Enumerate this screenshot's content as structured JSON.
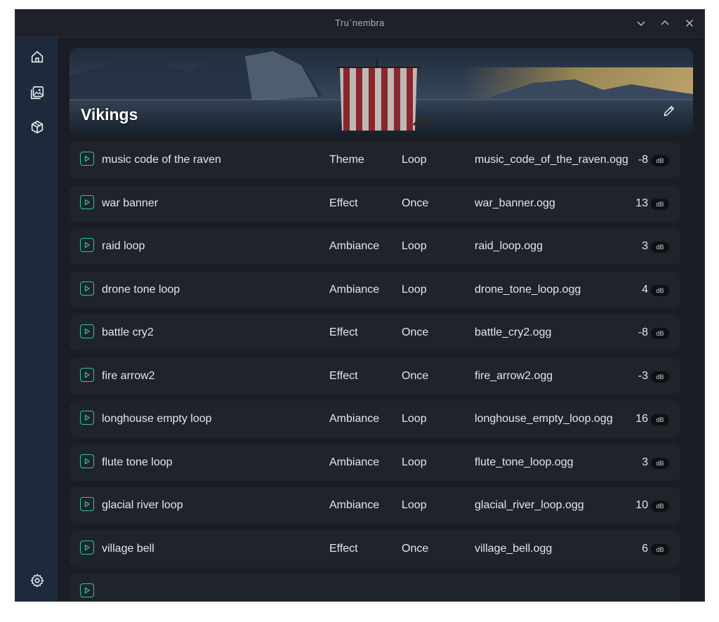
{
  "window": {
    "title": "Tru`nembra",
    "controls": [
      "chevron-down-icon",
      "chevron-up-icon",
      "close-icon"
    ]
  },
  "sidebar": {
    "items": [
      {
        "name": "home",
        "icon": "home-icon"
      },
      {
        "name": "gallery",
        "icon": "image-gallery-icon"
      },
      {
        "name": "packages",
        "icon": "package-icon"
      }
    ],
    "bottom": {
      "name": "settings",
      "icon": "gear-icon"
    }
  },
  "banner": {
    "title": "Vikings",
    "edit_icon": "pencil-icon"
  },
  "unit_label": "dB",
  "colors": {
    "accent": "#2dc4a8",
    "sidebar": "#1d2a3b",
    "background": "#1a1e24",
    "row": "#1f242b"
  },
  "sounds": [
    {
      "name": "music code of the raven",
      "type": "Theme",
      "mode": "Loop",
      "file": "music_code_of_the_raven.ogg",
      "volume": "-8"
    },
    {
      "name": "war banner",
      "type": "Effect",
      "mode": "Once",
      "file": "war_banner.ogg",
      "volume": "13"
    },
    {
      "name": "raid loop",
      "type": "Ambiance",
      "mode": "Loop",
      "file": "raid_loop.ogg",
      "volume": "3"
    },
    {
      "name": "drone tone loop",
      "type": "Ambiance",
      "mode": "Loop",
      "file": "drone_tone_loop.ogg",
      "volume": "4"
    },
    {
      "name": "battle cry2",
      "type": "Effect",
      "mode": "Once",
      "file": "battle_cry2.ogg",
      "volume": "-8"
    },
    {
      "name": "fire arrow2",
      "type": "Effect",
      "mode": "Once",
      "file": "fire_arrow2.ogg",
      "volume": "-3"
    },
    {
      "name": "longhouse empty loop",
      "type": "Ambiance",
      "mode": "Loop",
      "file": "longhouse_empty_loop.ogg",
      "volume": "16"
    },
    {
      "name": "flute tone loop",
      "type": "Ambiance",
      "mode": "Loop",
      "file": "flute_tone_loop.ogg",
      "volume": "3"
    },
    {
      "name": "glacial river loop",
      "type": "Ambiance",
      "mode": "Loop",
      "file": "glacial_river_loop.ogg",
      "volume": "10"
    },
    {
      "name": "village bell",
      "type": "Effect",
      "mode": "Once",
      "file": "village_bell.ogg",
      "volume": "6"
    }
  ]
}
